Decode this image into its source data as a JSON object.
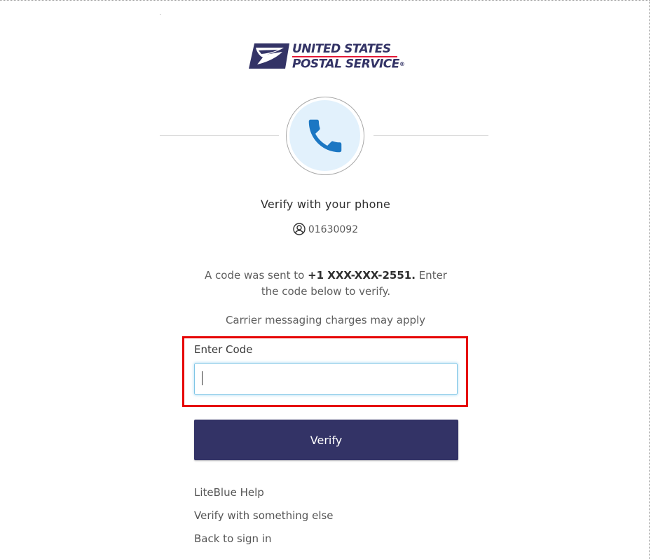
{
  "brand": {
    "line1": "UNITED STATES",
    "line2": "POSTAL SERVICE",
    "registered": "®",
    "colors": {
      "navy": "#333366",
      "red": "#e31837"
    }
  },
  "factor_icon": "phone-icon",
  "heading": "Verify with your phone",
  "user": {
    "icon": "user-circle-icon",
    "id": "01630092"
  },
  "instructions": {
    "prefix": "A code was sent to ",
    "phone": "+1 XXX-XXX-2551.",
    "suffix": " Enter the code below to verify."
  },
  "carrier_note": "Carrier messaging charges may apply",
  "code_field": {
    "label": "Enter Code",
    "value": "",
    "placeholder": ""
  },
  "verify_button": {
    "label": "Verify",
    "color": "#333366"
  },
  "links": {
    "help": "LiteBlue Help",
    "verify_else": "Verify with something else",
    "back": "Back to sign in"
  },
  "highlight_color": "#e60000"
}
